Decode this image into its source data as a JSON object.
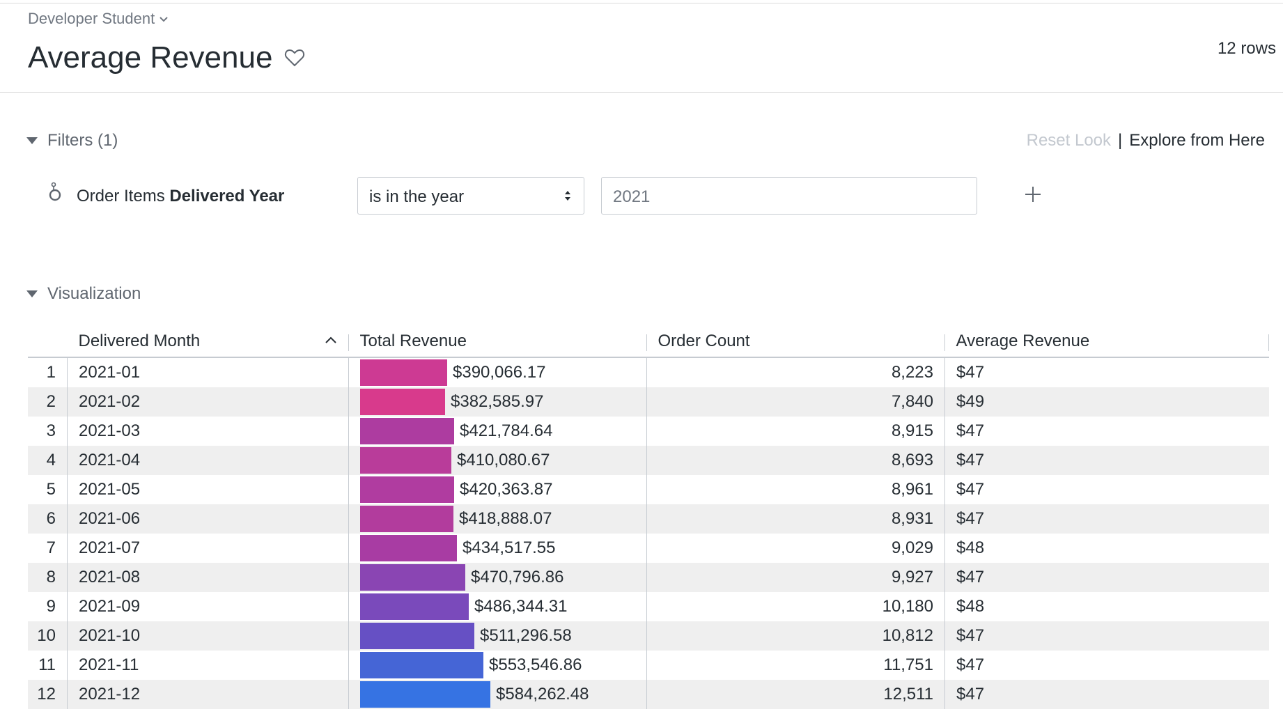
{
  "breadcrumb": "Developer Student",
  "title": "Average Revenue",
  "row_count_text": "12 rows",
  "filters": {
    "header": "Filters (1)",
    "reset_label": "Reset Look",
    "separator": "|",
    "explore_label": "Explore from Here",
    "field_prefix": "Order Items ",
    "field_name": "Delivered Year",
    "operator": "is in the year",
    "value": "2021"
  },
  "visualization": {
    "header": "Visualization",
    "columns": [
      "Delivered Month",
      "Total Revenue",
      "Order Count",
      "Average Revenue"
    ],
    "sort": "ascending",
    "rows": [
      {
        "index": "1",
        "month": "2021-01",
        "revenue": "$390,066.17",
        "revenue_value": 390066.17,
        "count": "8,223",
        "avg": "$47",
        "color": "#cd3a93"
      },
      {
        "index": "2",
        "month": "2021-02",
        "revenue": "$382,585.97",
        "revenue_value": 382585.97,
        "count": "7,840",
        "avg": "$49",
        "color": "#d83a8c"
      },
      {
        "index": "3",
        "month": "2021-03",
        "revenue": "$421,784.64",
        "revenue_value": 421784.64,
        "count": "8,915",
        "avg": "$47",
        "color": "#ad3ca0"
      },
      {
        "index": "4",
        "month": "2021-04",
        "revenue": "$410,080.67",
        "revenue_value": 410080.67,
        "count": "8,693",
        "avg": "$47",
        "color": "#b93c9a"
      },
      {
        "index": "5",
        "month": "2021-05",
        "revenue": "$420,363.87",
        "revenue_value": 420363.87,
        "count": "8,961",
        "avg": "$47",
        "color": "#b03ca0"
      },
      {
        "index": "6",
        "month": "2021-06",
        "revenue": "$418,888.07",
        "revenue_value": 418888.07,
        "count": "8,931",
        "avg": "$47",
        "color": "#b23c9d"
      },
      {
        "index": "7",
        "month": "2021-07",
        "revenue": "$434,517.55",
        "revenue_value": 434517.55,
        "count": "9,029",
        "avg": "$48",
        "color": "#a83ca3"
      },
      {
        "index": "8",
        "month": "2021-08",
        "revenue": "$470,796.86",
        "revenue_value": 470796.86,
        "count": "9,927",
        "avg": "$47",
        "color": "#8a45b3"
      },
      {
        "index": "9",
        "month": "2021-09",
        "revenue": "$486,344.31",
        "revenue_value": 486344.31,
        "count": "10,180",
        "avg": "$48",
        "color": "#7a4abb"
      },
      {
        "index": "10",
        "month": "2021-10",
        "revenue": "$511,296.58",
        "revenue_value": 511296.58,
        "count": "10,812",
        "avg": "$47",
        "color": "#6650c4"
      },
      {
        "index": "11",
        "month": "2021-11",
        "revenue": "$553,546.86",
        "revenue_value": 553546.86,
        "count": "11,751",
        "avg": "$47",
        "color": "#4565d6"
      },
      {
        "index": "12",
        "month": "2021-12",
        "revenue": "$584,262.48",
        "revenue_value": 584262.48,
        "count": "12,511",
        "avg": "$47",
        "color": "#3673e3"
      }
    ]
  },
  "icons": {
    "breadcrumb": "chevron-down-icon",
    "favorite": "heart-icon",
    "section": "caret-down-icon",
    "filter_field": "dimension-icon",
    "select": "select-arrows-icon",
    "add": "plus-icon",
    "sort": "sort-ascending-icon"
  }
}
